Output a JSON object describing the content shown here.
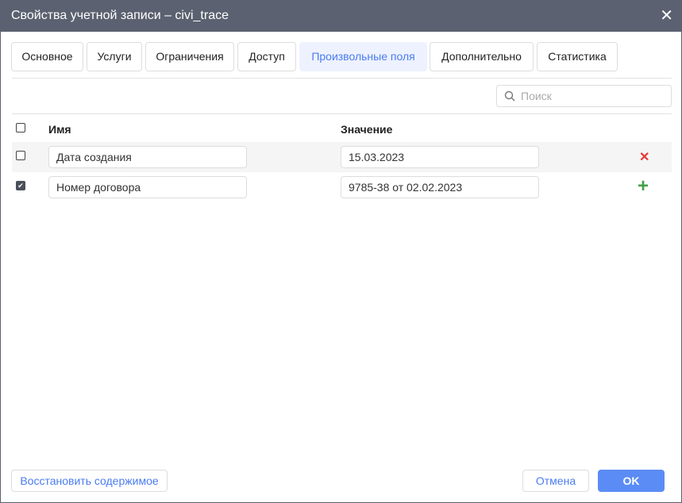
{
  "title": "Свойства учетной записи – civi_trace",
  "tabs": [
    {
      "label": "Основное"
    },
    {
      "label": "Услуги"
    },
    {
      "label": "Ограничения"
    },
    {
      "label": "Доступ"
    },
    {
      "label": "Произвольные поля",
      "active": true
    },
    {
      "label": "Дополнительно"
    },
    {
      "label": "Статистика"
    }
  ],
  "search": {
    "placeholder": "Поиск",
    "icon": "search-icon"
  },
  "table": {
    "columns": [
      "Имя",
      "Значение"
    ],
    "rows": [
      {
        "checked": false,
        "name": "Дата создания",
        "value": "15.03.2023",
        "action": "delete-icon"
      },
      {
        "checked": true,
        "name": "Номер договора",
        "value": "9785-38 от 02.02.2023",
        "action": "add-icon"
      }
    ]
  },
  "footer": {
    "restore": "Восстановить содержимое",
    "cancel": "Отмена",
    "ok": "OK"
  },
  "colors": {
    "accent": "#5b8cf5",
    "titlebar": "#5b6170",
    "delete": "#e53935",
    "add": "#43a047"
  }
}
